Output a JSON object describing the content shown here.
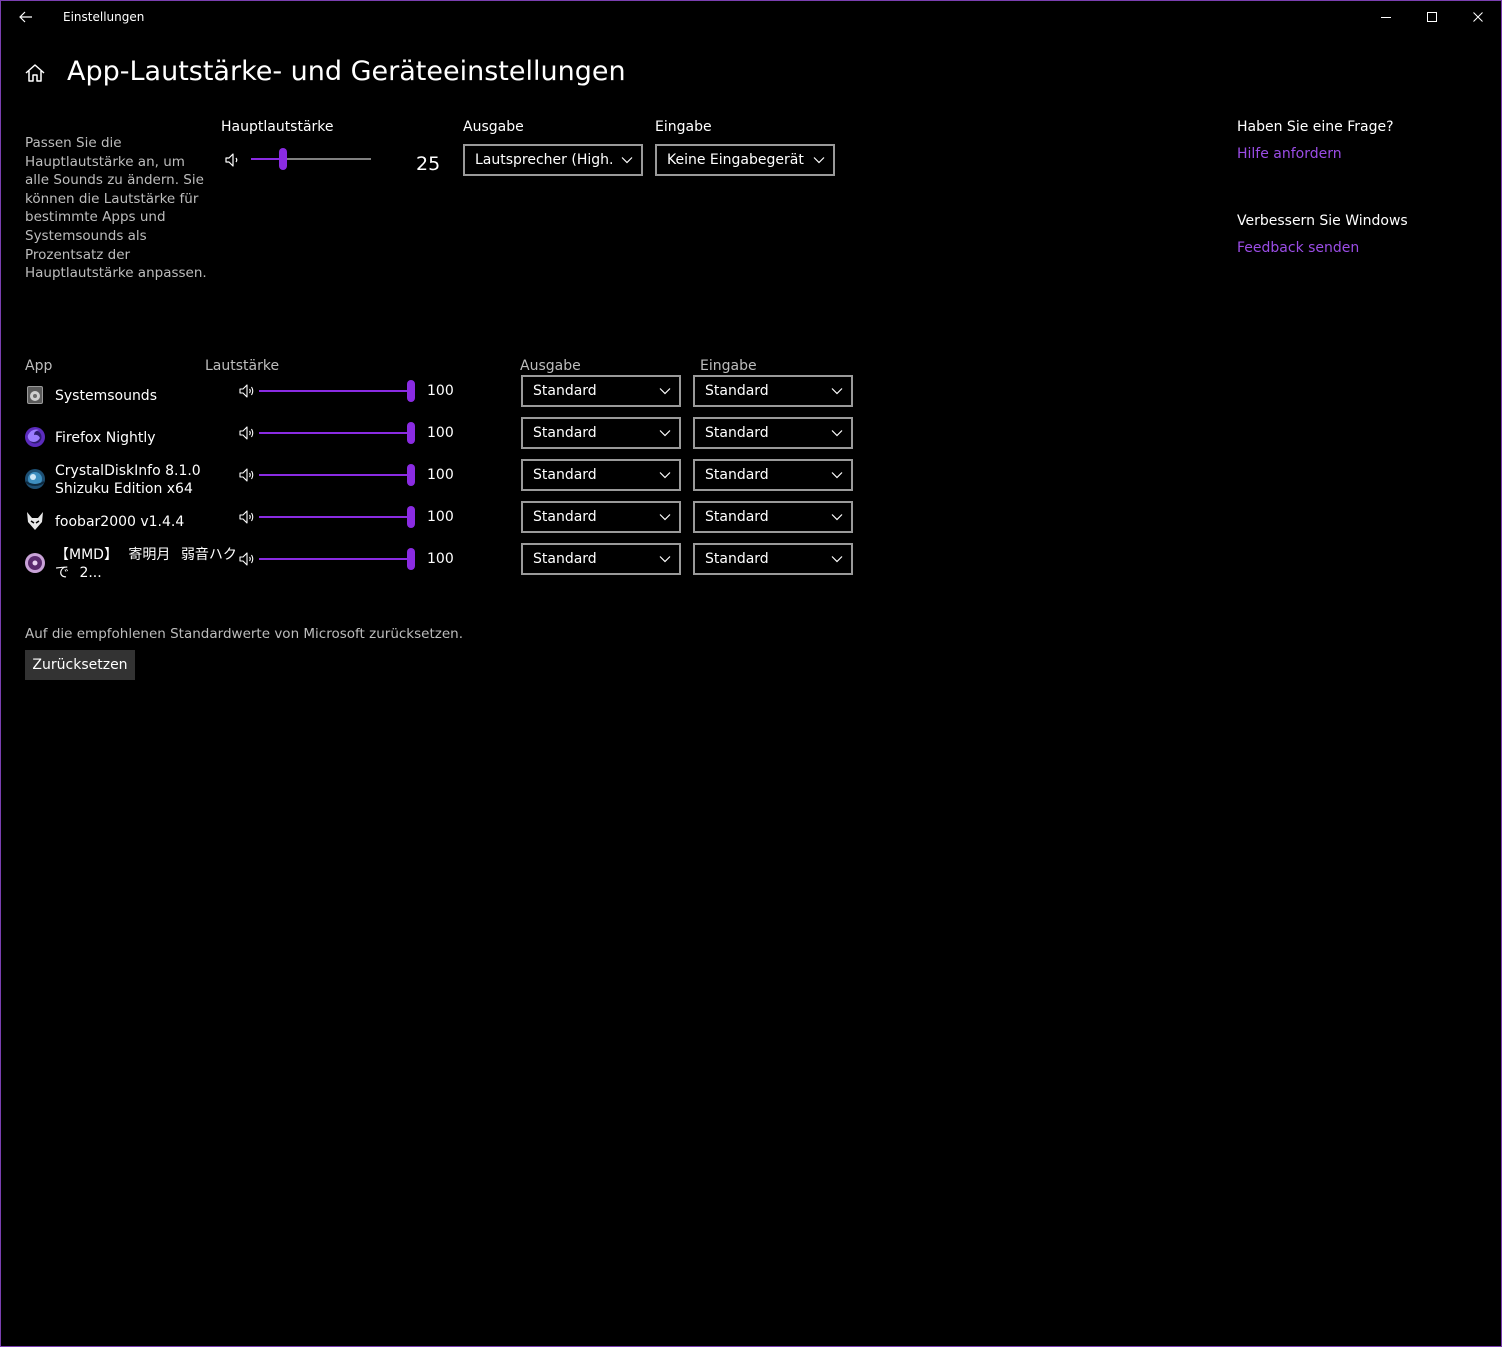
{
  "window": {
    "title": "Einstellungen"
  },
  "page": {
    "title": "App-Lautstärke- und Geräteeinstellungen"
  },
  "master": {
    "description": "Passen Sie die Hauptlautstärke an, um alle Sounds zu ändern. Sie können die Lautstärke für bestimmte Apps und Systemsounds als Prozentsatz der Hauptlautstärke anpassen.",
    "volume_label": "Hauptlautstärke",
    "volume_value": "25",
    "output_label": "Ausgabe",
    "output_value": "Lautsprecher (High...",
    "input_label": "Eingabe",
    "input_value": "Keine Eingabegerät..."
  },
  "help": {
    "question": "Haben Sie eine Frage?",
    "help_link": "Hilfe anfordern",
    "improve": "Verbessern Sie Windows",
    "feedback_link": "Feedback senden"
  },
  "apps_table": {
    "headers": {
      "app": "App",
      "volume": "Lautstärke",
      "output": "Ausgabe",
      "input": "Eingabe"
    },
    "rows": [
      {
        "name": "Systemsounds",
        "volume": "100",
        "output": "Standard",
        "input": "Standard",
        "icon": "system-sounds-icon"
      },
      {
        "name": "Firefox Nightly",
        "volume": "100",
        "output": "Standard",
        "input": "Standard",
        "icon": "firefox-nightly-icon"
      },
      {
        "name": "CrystalDiskInfo 8.1.0 Shizuku Edition x64",
        "volume": "100",
        "output": "Standard",
        "input": "Standard",
        "icon": "crystaldiskinfo-icon"
      },
      {
        "name": "foobar2000 v1.4.4",
        "volume": "100",
        "output": "Standard",
        "input": "Standard",
        "icon": "foobar2000-icon"
      },
      {
        "name": "【MMD】 寄明月 弱音ハクで 2...",
        "volume": "100",
        "output": "Standard",
        "input": "Standard",
        "icon": "media-player-icon"
      }
    ]
  },
  "reset": {
    "description": "Auf die empfohlenen Standardwerte von Microsoft zurücksetzen.",
    "button_label": "Zurücksetzen"
  },
  "colors": {
    "accent": "#8a2be2",
    "link": "#9b4de6",
    "background": "#000000"
  }
}
